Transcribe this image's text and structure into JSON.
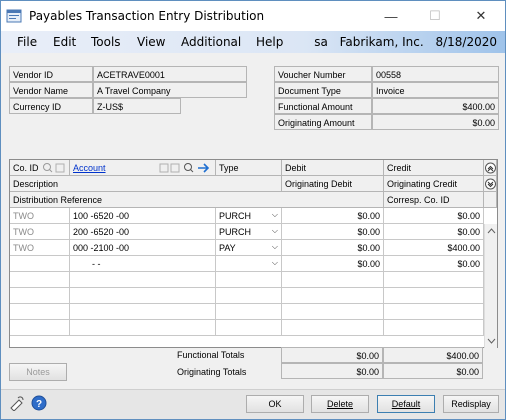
{
  "window": {
    "title": "Payables Transaction Entry Distribution",
    "minimize": "—",
    "maximize": "☐",
    "close": "✕"
  },
  "menu": {
    "items": [
      "File",
      "Edit",
      "Tools",
      "View",
      "Additional",
      "Help"
    ],
    "user": "sa",
    "company": "Fabrikam, Inc.",
    "date": "8/18/2020"
  },
  "header": {
    "vendor_id_label": "Vendor ID",
    "vendor_id": "ACETRAVE0001",
    "vendor_name_label": "Vendor Name",
    "vendor_name": "A Travel Company",
    "currency_id_label": "Currency ID",
    "currency_id": "Z-US$",
    "voucher_number_label": "Voucher Number",
    "voucher_number": "00558",
    "document_type_label": "Document Type",
    "document_type": "Invoice",
    "functional_amount_label": "Functional Amount",
    "functional_amount": "$400.00",
    "originating_amount_label": "Originating Amount",
    "originating_amount": "$0.00"
  },
  "grid": {
    "col_co_id": "Co. ID",
    "col_account": "Account",
    "col_type": "Type",
    "col_debit": "Debit",
    "col_credit": "Credit",
    "col_description": "Description",
    "col_orig_debit": "Originating Debit",
    "col_orig_credit": "Originating Credit",
    "col_dist_ref": "Distribution Reference",
    "col_corresp": "Corresp. Co. ID",
    "rows": [
      {
        "co": "TWO",
        "account": "100 -6520 -00",
        "type": "PURCH",
        "debit": "$0.00",
        "credit": "$0.00"
      },
      {
        "co": "TWO",
        "account": "200 -6520 -00",
        "type": "PURCH",
        "debit": "$0.00",
        "credit": "$0.00"
      },
      {
        "co": "TWO",
        "account": "000 -2100 -00",
        "type": "PAY",
        "debit": "$0.00",
        "credit": "$400.00"
      },
      {
        "co": "",
        "account": "-      -",
        "type": "",
        "debit": "$0.00",
        "credit": "$0.00"
      }
    ]
  },
  "totals": {
    "functional_label": "Functional Totals",
    "functional_debit": "$0.00",
    "functional_credit": "$400.00",
    "originating_label": "Originating Totals",
    "originating_debit": "$0.00",
    "originating_credit": "$0.00"
  },
  "buttons": {
    "notes": "Notes",
    "ok": "OK",
    "delete": "Delete",
    "default": "Default",
    "redisplay": "Redisplay"
  }
}
